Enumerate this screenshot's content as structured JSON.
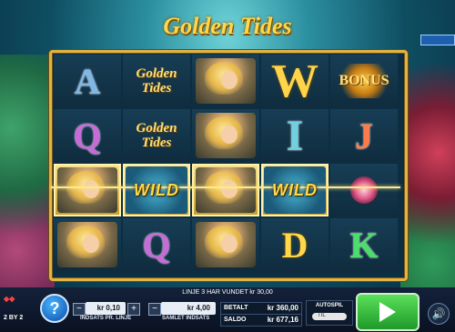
{
  "game": {
    "title": "Golden Tides"
  },
  "reels": [
    [
      "A",
      "GOLDEN_TIDES",
      "MERMAID",
      "W",
      "BONUS"
    ],
    [
      "Q",
      "GOLDEN_TIDES",
      "MERMAID",
      "I",
      "J"
    ],
    [
      "MERMAID",
      "WILD",
      "MERMAID",
      "WILD",
      "FLOWER"
    ],
    [
      "MERMAID",
      "Q",
      "MERMAID",
      "D",
      "K"
    ]
  ],
  "symbols": {
    "golden_tides_line1": "Golden",
    "golden_tides_line2": "Tides",
    "wild": "WILD",
    "bonus": "BONUS"
  },
  "win_message": "LINJE 3 HAR VUNDET kr 30,00",
  "controls": {
    "line_bet": {
      "value": "kr 0,10",
      "label": "INDSATS PR. LINJE",
      "minus": "−",
      "plus": "+"
    },
    "total_bet": {
      "value": "kr 4,00",
      "label": "SAMLET INDSATS"
    },
    "paid": {
      "label": "BETALT",
      "value": "kr 360,00"
    },
    "balance": {
      "label": "SALDO",
      "value": "kr 677,16"
    },
    "autoplay": {
      "label": "AUTOSPIL",
      "toggle": "TIL"
    },
    "help": "?",
    "sound": "🔊"
  },
  "brand": {
    "line1": "2 BY 2"
  },
  "colors": {
    "frame": "#e2b443",
    "spin": "#2fb83a",
    "accent": "#ffd84a"
  }
}
